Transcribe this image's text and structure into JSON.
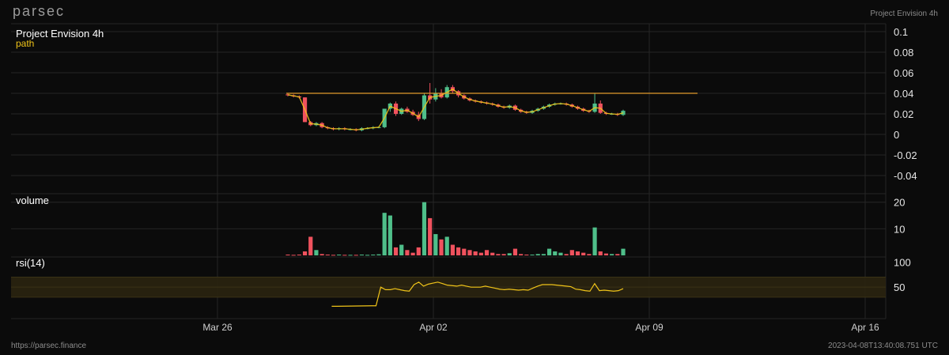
{
  "brand": "parsec",
  "header_right": "Project Envision 4h",
  "footer_left": "https://parsec.finance",
  "footer_right": "2023-04-08T13:40:08.751 UTC",
  "colors": {
    "up": "#4fbf8a",
    "down": "#f0525e",
    "path": "#f0c419",
    "ref_line": "#e09a2c",
    "grid": "#262626",
    "rsi_band": "#2a2410",
    "title": "#ffffff"
  },
  "chart_data": [
    {
      "type": "candlestick",
      "title": "Project Envision 4h",
      "legend": [
        "path"
      ],
      "yticks": [
        0.1,
        0.08,
        0.06,
        0.04,
        0.02,
        0,
        -0.02,
        -0.04
      ],
      "ylim": [
        -0.05,
        0.1
      ],
      "xticks": [
        "Mar 26",
        "Apr 02",
        "Apr 09",
        "Apr 16"
      ],
      "reference_line": 0.04,
      "series": [
        {
          "name": "path",
          "candles": [
            [
              0.039,
              0.04,
              0.037,
              0.038
            ],
            [
              0.038,
              0.039,
              0.036,
              0.037
            ],
            [
              0.037,
              0.038,
              0.035,
              0.036
            ],
            [
              0.036,
              0.036,
              0.012,
              0.012
            ],
            [
              0.012,
              0.013,
              0.008,
              0.009
            ],
            [
              0.009,
              0.012,
              0.008,
              0.011
            ],
            [
              0.011,
              0.012,
              0.006,
              0.007
            ],
            [
              0.007,
              0.008,
              0.005,
              0.006
            ],
            [
              0.006,
              0.007,
              0.004,
              0.005
            ],
            [
              0.005,
              0.007,
              0.004,
              0.006
            ],
            [
              0.006,
              0.007,
              0.004,
              0.005
            ],
            [
              0.005,
              0.006,
              0.004,
              0.005
            ],
            [
              0.005,
              0.006,
              0.003,
              0.004
            ],
            [
              0.004,
              0.007,
              0.003,
              0.006
            ],
            [
              0.006,
              0.007,
              0.005,
              0.006
            ],
            [
              0.006,
              0.008,
              0.005,
              0.007
            ],
            [
              0.007,
              0.008,
              0.006,
              0.007
            ],
            [
              0.007,
              0.025,
              0.006,
              0.025
            ],
            [
              0.025,
              0.031,
              0.022,
              0.03
            ],
            [
              0.03,
              0.032,
              0.018,
              0.02
            ],
            [
              0.02,
              0.026,
              0.019,
              0.025
            ],
            [
              0.025,
              0.027,
              0.021,
              0.022
            ],
            [
              0.022,
              0.024,
              0.018,
              0.019
            ],
            [
              0.019,
              0.022,
              0.013,
              0.015
            ],
            [
              0.015,
              0.04,
              0.014,
              0.038
            ],
            [
              0.038,
              0.05,
              0.03,
              0.034
            ],
            [
              0.034,
              0.045,
              0.032,
              0.04
            ],
            [
              0.04,
              0.044,
              0.035,
              0.036
            ],
            [
              0.036,
              0.048,
              0.035,
              0.046
            ],
            [
              0.046,
              0.048,
              0.04,
              0.042
            ],
            [
              0.042,
              0.043,
              0.036,
              0.038
            ],
            [
              0.038,
              0.039,
              0.034,
              0.035
            ],
            [
              0.035,
              0.036,
              0.032,
              0.033
            ],
            [
              0.033,
              0.034,
              0.031,
              0.032
            ],
            [
              0.032,
              0.033,
              0.03,
              0.031
            ],
            [
              0.031,
              0.032,
              0.029,
              0.03
            ],
            [
              0.03,
              0.031,
              0.028,
              0.029
            ],
            [
              0.029,
              0.03,
              0.026,
              0.027
            ],
            [
              0.027,
              0.028,
              0.025,
              0.026
            ],
            [
              0.026,
              0.029,
              0.025,
              0.028
            ],
            [
              0.028,
              0.029,
              0.023,
              0.024
            ],
            [
              0.024,
              0.025,
              0.021,
              0.022
            ],
            [
              0.022,
              0.023,
              0.02,
              0.021
            ],
            [
              0.021,
              0.024,
              0.02,
              0.023
            ],
            [
              0.023,
              0.026,
              0.022,
              0.025
            ],
            [
              0.025,
              0.028,
              0.024,
              0.027
            ],
            [
              0.027,
              0.03,
              0.026,
              0.029
            ],
            [
              0.029,
              0.031,
              0.028,
              0.03
            ],
            [
              0.03,
              0.031,
              0.029,
              0.03
            ],
            [
              0.03,
              0.031,
              0.028,
              0.029
            ],
            [
              0.029,
              0.03,
              0.026,
              0.027
            ],
            [
              0.027,
              0.028,
              0.024,
              0.025
            ],
            [
              0.025,
              0.026,
              0.022,
              0.023
            ],
            [
              0.023,
              0.024,
              0.021,
              0.022
            ],
            [
              0.022,
              0.04,
              0.021,
              0.03
            ],
            [
              0.03,
              0.033,
              0.02,
              0.021
            ],
            [
              0.021,
              0.022,
              0.019,
              0.02
            ],
            [
              0.02,
              0.021,
              0.019,
              0.02
            ],
            [
              0.02,
              0.021,
              0.018,
              0.019
            ],
            [
              0.019,
              0.024,
              0.018,
              0.023
            ]
          ]
        }
      ]
    },
    {
      "type": "bar",
      "title": "volume",
      "yticks": [
        20,
        10
      ],
      "ylim": [
        0,
        22
      ],
      "values": [
        0.3,
        0.2,
        0.3,
        1.5,
        7,
        2,
        0.5,
        0.3,
        0.2,
        0.3,
        0.2,
        0.2,
        0.2,
        0.3,
        0.2,
        0.3,
        0.4,
        16,
        15,
        3,
        4,
        2,
        1,
        3,
        20,
        14,
        8,
        6,
        7,
        4,
        3,
        2.5,
        2,
        1.5,
        1,
        2,
        1,
        0.5,
        0.5,
        0.8,
        2.5,
        0.5,
        0.3,
        0.3,
        0.5,
        0.5,
        2.5,
        1.5,
        1,
        0.5,
        2,
        1.5,
        1,
        0.5,
        10.5,
        1.5,
        0.7,
        0.5,
        0.5,
        2.5
      ]
    },
    {
      "type": "line",
      "title": "rsi(14)",
      "yticks": [
        100,
        50
      ],
      "ylim": [
        0,
        110
      ],
      "band": [
        30,
        70
      ],
      "start_index": 13,
      "values": [
        12,
        12,
        13,
        13,
        50,
        45,
        45,
        47,
        45,
        43,
        42,
        55,
        60,
        52,
        56,
        58,
        60,
        57,
        54,
        53,
        52,
        54,
        52,
        50,
        50,
        50,
        52,
        50,
        48,
        46,
        45,
        46,
        45,
        44,
        45,
        44,
        48,
        52,
        55,
        55,
        55,
        54,
        53,
        52,
        51,
        46,
        45,
        43,
        42,
        57,
        43,
        44,
        43,
        42,
        43,
        47
      ]
    }
  ]
}
